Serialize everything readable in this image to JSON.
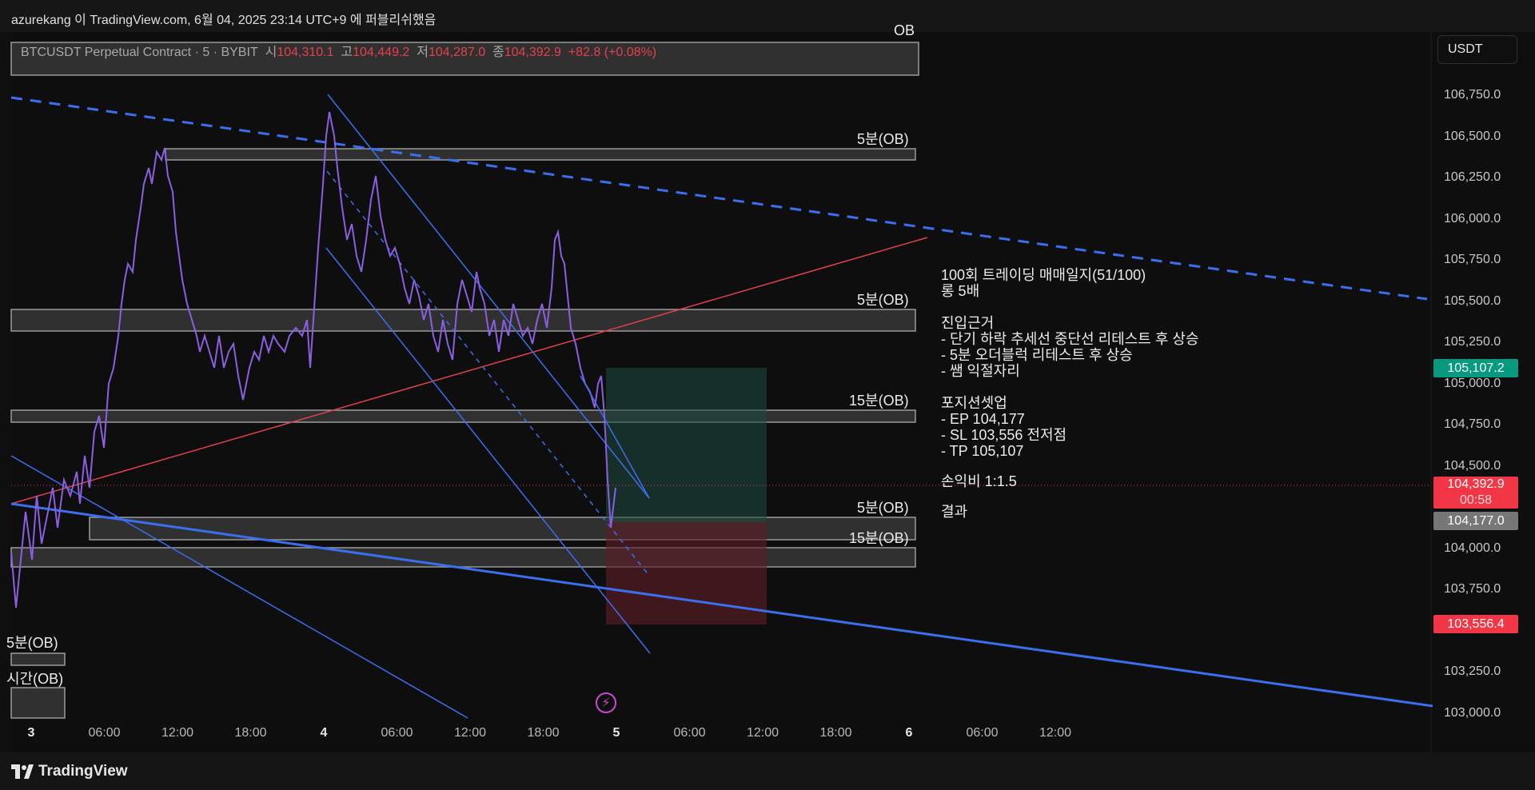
{
  "header": {
    "publish_info": "azurekang 이 TradingView.com, 6월 04, 2025 23:14 UTC+9 에 퍼블리쉬했음"
  },
  "symbol": {
    "name": "BTCUSDT Perpetual Contract · 5 · BYBIT",
    "open_label": "시",
    "open": "104,310.1",
    "high_label": "고",
    "high": "104,449.2",
    "low_label": "저",
    "low": "104,287.0",
    "close_label": "종",
    "close": "104,392.9",
    "change": "+82.8 (+0.08%)"
  },
  "currency_button": "USDT",
  "price_axis": {
    "ticks": [
      "106,750.0",
      "106,500.0",
      "106,250.0",
      "106,000.0",
      "105,750.0",
      "105,500.0",
      "105,250.0",
      "105,000.0",
      "104,750.0",
      "104,500.0",
      "104,000.0",
      "103,750.0",
      "103,250.0",
      "103,000.0"
    ],
    "tags": {
      "tp": "105,107.2",
      "last": "104,392.9",
      "countdown": "00:58",
      "ep": "104,177.0",
      "sl": "103,556.4"
    }
  },
  "time_axis": {
    "ticks": [
      "3",
      "06:00",
      "12:00",
      "18:00",
      "4",
      "06:00",
      "12:00",
      "18:00",
      "5",
      "06:00",
      "12:00",
      "18:00",
      "6",
      "06:00",
      "12:00"
    ]
  },
  "order_blocks": {
    "top": "OB",
    "ob_5m_1": "5분(OB)",
    "ob_5m_2": "5분(OB)",
    "ob_15m_1": "15분(OB)",
    "ob_5m_3": "5분(OB)",
    "ob_15m_2": "15분(OB)",
    "left_5m": "5분(OB)",
    "left_hour": "시간(OB)"
  },
  "note": {
    "title": "100회 트레이딩 매매일지(51/100)",
    "position": "롱 5배",
    "entry_heading": "진입근거",
    "entry_1": "- 단기 하락 추세선 중단선 리테스트 후 상승",
    "entry_2": "- 5분 오더블럭 리테스트 후 상승",
    "entry_3": "- 쌤 익절자리",
    "setup_heading": "포지션셋업",
    "ep": "- EP 104,177",
    "sl": "- SL 103,556 전저점",
    "tp": "- TP 105,107",
    "rr": "손익비 1:1.5",
    "result": "결과"
  },
  "footer": {
    "brand": "TradingView"
  },
  "colors": {
    "background": "#0e0e0e",
    "up": "#26a69a",
    "down": "#f23645",
    "trendline_blue": "#3b6ff0",
    "trendline_red": "#e0414b",
    "order_block": "#4a4a4a"
  }
}
